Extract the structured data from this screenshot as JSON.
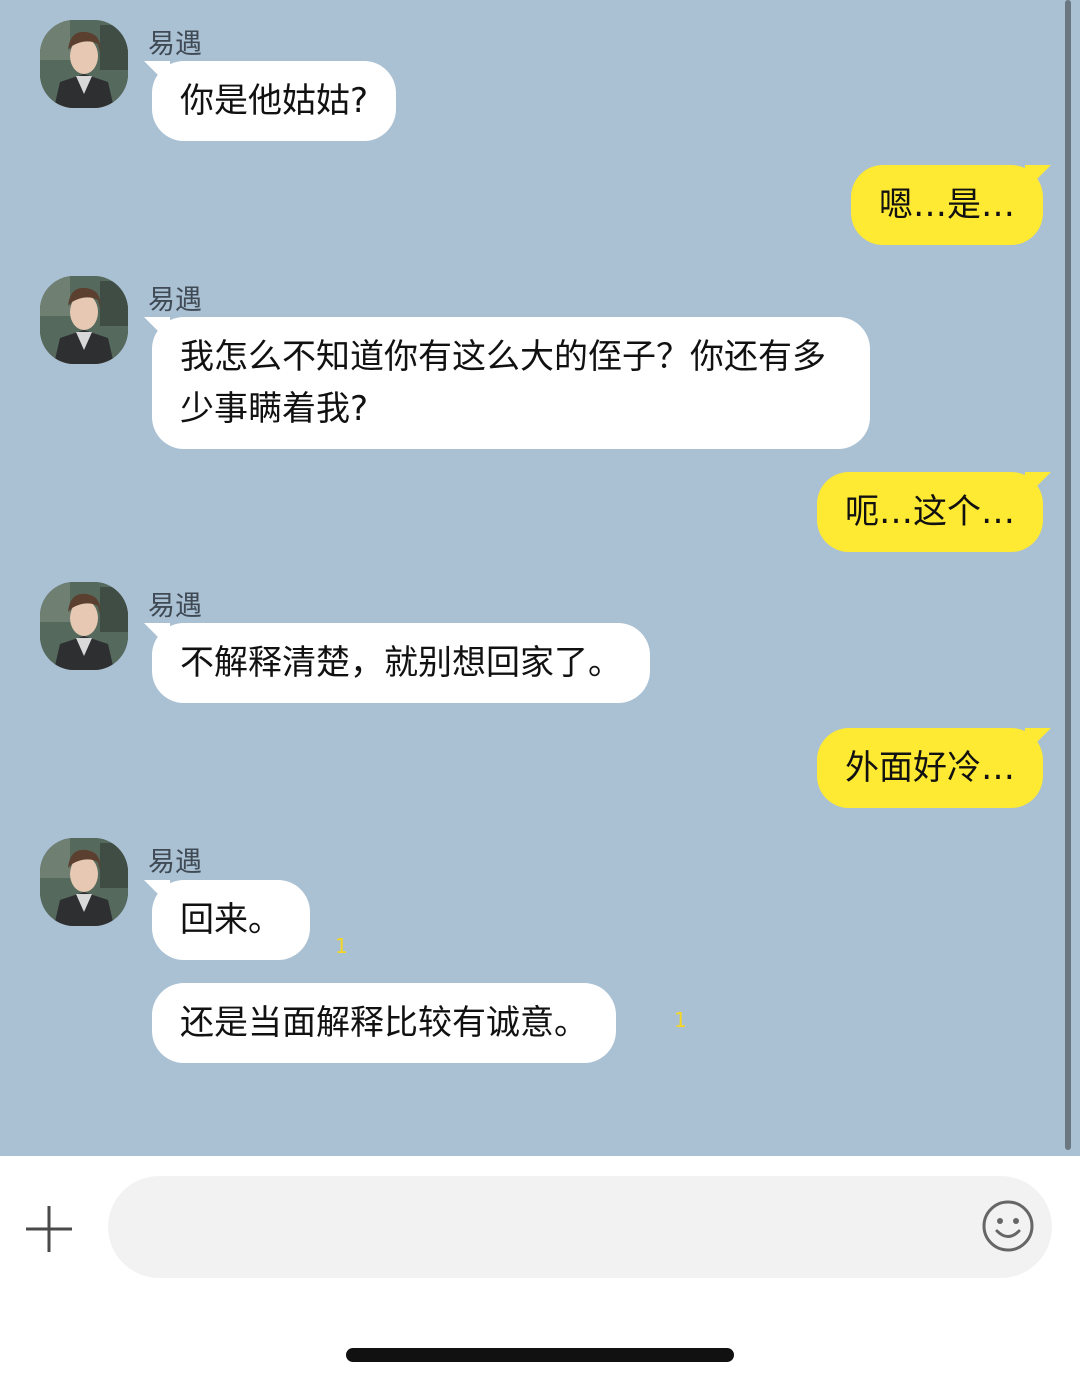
{
  "contact": {
    "name": "易遇"
  },
  "messages": [
    {
      "sender": "易遇",
      "text": "你是他姑姑?"
    },
    {
      "sender": "me",
      "text": "嗯…是…"
    },
    {
      "sender": "易遇",
      "text": "我怎么不知道你有这么大的侄子？你还有多少事瞒着我?"
    },
    {
      "sender": "me",
      "text": "呃…这个…"
    },
    {
      "sender": "易遇",
      "text": "不解释清楚，就别想回家了。"
    },
    {
      "sender": "me",
      "text": "外面好冷…"
    },
    {
      "sender": "易遇",
      "text": "回来。",
      "unread": "1"
    },
    {
      "sender": "易遇",
      "text": "还是当面解释比较有诚意。",
      "unread": "1"
    }
  ],
  "input": {
    "placeholder": ""
  },
  "icons": {
    "attach": "plus-icon",
    "emoji": "smiley-icon"
  },
  "colors": {
    "chat_background": "#aac0d3",
    "outgoing_bubble": "#fee933",
    "incoming_bubble": "#ffffff",
    "unread_count": "#f5d623"
  }
}
